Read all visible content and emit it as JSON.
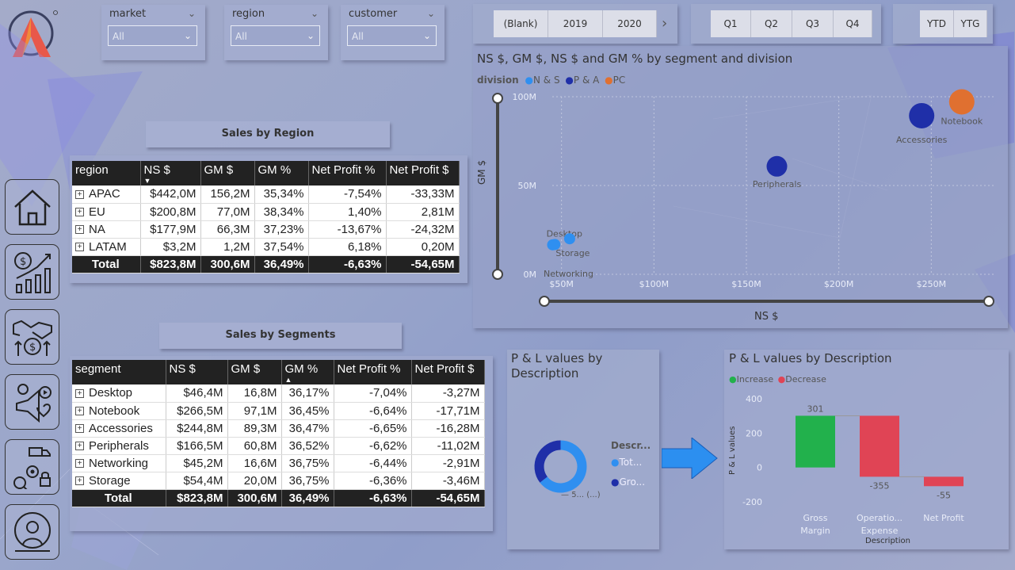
{
  "filters": [
    {
      "label": "market",
      "value": "All"
    },
    {
      "label": "region",
      "value": "All"
    },
    {
      "label": "customer",
      "value": "All"
    }
  ],
  "year_buttons": [
    "(Blank)",
    "2019",
    "2020"
  ],
  "quarter_buttons": [
    "Q1",
    "Q2",
    "Q3",
    "Q4"
  ],
  "period_buttons": [
    "YTD",
    "YTG"
  ],
  "scatter": {
    "title": "NS $, GM $, NS $ and GM % by segment and division",
    "legend_title": "division",
    "legend": [
      {
        "name": "N & S",
        "color": "#2f8ff0"
      },
      {
        "name": "P & A",
        "color": "#1f2fa8"
      },
      {
        "name": "PC",
        "color": "#e07030"
      }
    ],
    "xlabel": "NS $",
    "ylabel": "GM $",
    "x_ticks": [
      "$50M",
      "$100M",
      "$150M",
      "$200M",
      "$250M"
    ],
    "y_ticks": [
      "100M",
      "50M",
      "0M"
    ]
  },
  "region_table": {
    "title": "Sales by Region",
    "columns": [
      "region",
      "NS $",
      "GM $",
      "GM %",
      "Net Profit %",
      "Net Profit $"
    ],
    "rows": [
      [
        "APAC",
        "$442,0M",
        "156,2M",
        "35,34%",
        "-7,54%",
        "-33,33M"
      ],
      [
        "EU",
        "$200,8M",
        "77,0M",
        "38,34%",
        "1,40%",
        "2,81M"
      ],
      [
        "NA",
        "$177,9M",
        "66,3M",
        "37,23%",
        "-13,67%",
        "-24,32M"
      ],
      [
        "LATAM",
        "$3,2M",
        "1,2M",
        "37,54%",
        "6,18%",
        "0,20M"
      ]
    ],
    "total": [
      "Total",
      "$823,8M",
      "300,6M",
      "36,49%",
      "-6,63%",
      "-54,65M"
    ]
  },
  "segment_table": {
    "title": "Sales by Segments",
    "columns": [
      "segment",
      "NS $",
      "GM $",
      "GM %",
      "Net Profit %",
      "Net Profit $"
    ],
    "rows": [
      [
        "Desktop",
        "$46,4M",
        "16,8M",
        "36,17%",
        "-7,04%",
        "-3,27M"
      ],
      [
        "Notebook",
        "$266,5M",
        "97,1M",
        "36,45%",
        "-6,64%",
        "-17,71M"
      ],
      [
        "Accessories",
        "$244,8M",
        "89,3M",
        "36,47%",
        "-6,65%",
        "-16,28M"
      ],
      [
        "Peripherals",
        "$166,5M",
        "60,8M",
        "36,52%",
        "-6,62%",
        "-11,02M"
      ],
      [
        "Networking",
        "$45,2M",
        "16,6M",
        "36,75%",
        "-6,44%",
        "-2,91M"
      ],
      [
        "Storage",
        "$54,4M",
        "20,0M",
        "36,75%",
        "-6,36%",
        "-3,46M"
      ]
    ],
    "total": [
      "Total",
      "$823,8M",
      "300,6M",
      "36,49%",
      "-6,63%",
      "-54,65M"
    ]
  },
  "donut": {
    "title": "P & L values by Description",
    "legend_title": "Descr...",
    "legend": [
      {
        "name": "Tot...",
        "color": "#2f8ff0"
      },
      {
        "name": "Gro...",
        "color": "#1f2fa8"
      }
    ],
    "label": "5... (...)"
  },
  "waterfall": {
    "title": "P & L values by Description",
    "legend": [
      {
        "name": "Increase",
        "color": "#22b14c"
      },
      {
        "name": "Decrease",
        "color": "#e04455"
      }
    ],
    "ylabel": "P & L values",
    "xlabel": "Description",
    "y_ticks": [
      "400",
      "200",
      "0",
      "-200"
    ],
    "category_labels": [
      [
        "Gross",
        "Margin"
      ],
      [
        "Operatio...",
        "Expense"
      ],
      [
        "Net Profit"
      ]
    ],
    "value_labels": [
      "301",
      "-355",
      "-55"
    ]
  },
  "chart_data": [
    {
      "type": "scatter",
      "title": "NS $, GM $, NS $ and GM % by segment and division",
      "xlabel": "NS $",
      "ylabel": "GM $",
      "xlim": [
        45,
        285
      ],
      "ylim": [
        0,
        100
      ],
      "legend_placement": "top-left",
      "series": [
        {
          "name": "N & S",
          "color": "#2f8ff0",
          "points": [
            {
              "label": "Desktop",
              "x": 46.4,
              "y": 16.8
            },
            {
              "label": "Storage",
              "x": 54.4,
              "y": 20.0
            },
            {
              "label": "Networking",
              "x": 45.2,
              "y": 16.6
            }
          ]
        },
        {
          "name": "P & A",
          "color": "#1f2fa8",
          "points": [
            {
              "label": "Accessories",
              "x": 244.8,
              "y": 89.3
            },
            {
              "label": "Peripherals",
              "x": 166.5,
              "y": 60.8
            }
          ]
        },
        {
          "name": "PC",
          "color": "#e07030",
          "points": [
            {
              "label": "Notebook",
              "x": 266.5,
              "y": 97.1
            }
          ]
        }
      ]
    },
    {
      "type": "pie",
      "title": "P & L values by Description",
      "series": [
        {
          "name": "Tot...",
          "value": 54.65,
          "color": "#2f8ff0"
        },
        {
          "name": "Gro...",
          "value": 30.06,
          "color": "#1f2fa8"
        }
      ]
    },
    {
      "type": "bar",
      "title": "P & L values by Description",
      "categories": [
        "Gross Margin",
        "Operatio... Expense",
        "Net Profit"
      ],
      "values": [
        301,
        -355,
        -55
      ],
      "ylim": [
        -200,
        400
      ],
      "xlabel": "Description",
      "ylabel": "P & L values"
    }
  ]
}
